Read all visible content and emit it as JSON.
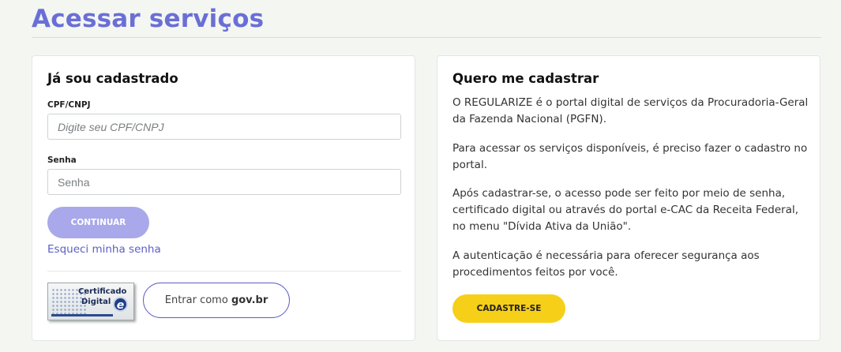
{
  "page": {
    "title": "Acessar serviços"
  },
  "login": {
    "heading": "Já sou cadastrado",
    "cpf_label": "CPF/CNPJ",
    "cpf_placeholder": "Digite seu CPF/CNPJ",
    "cpf_value": "",
    "senha_label": "Senha",
    "senha_placeholder": "Senha",
    "senha_value": "",
    "continue_label": "CONTINUAR",
    "forgot_label": "Esqueci minha senha",
    "cert_line1": "Certificado",
    "cert_line2": "Digital",
    "cert_icon": "e",
    "govbr_prefix": "Entrar como ",
    "govbr_brand": "gov.br"
  },
  "register": {
    "heading": "Quero me cadastrar",
    "paragraphs": [
      "O REGULARIZE é o portal digital de serviços da Procuradoria-Geral da Fazenda Nacional (PGFN).",
      "Para acessar os serviços disponíveis, é preciso fazer o cadastro no portal.",
      "Após cadastrar-se, o acesso pode ser feito por meio de senha, certificado digital ou através do portal e-CAC da Receita Federal, no menu \"Dívida Ativa da União\".",
      "A autenticação é necessária para oferecer segurança aos procedimentos feitos por você."
    ],
    "cadastre_label": "CADASTRE-SE"
  },
  "colors": {
    "accent": "#6a6fd6",
    "link": "#5b5fc7",
    "continue_button": "#a9a8ea",
    "cadastre_button": "#f6cf18"
  }
}
